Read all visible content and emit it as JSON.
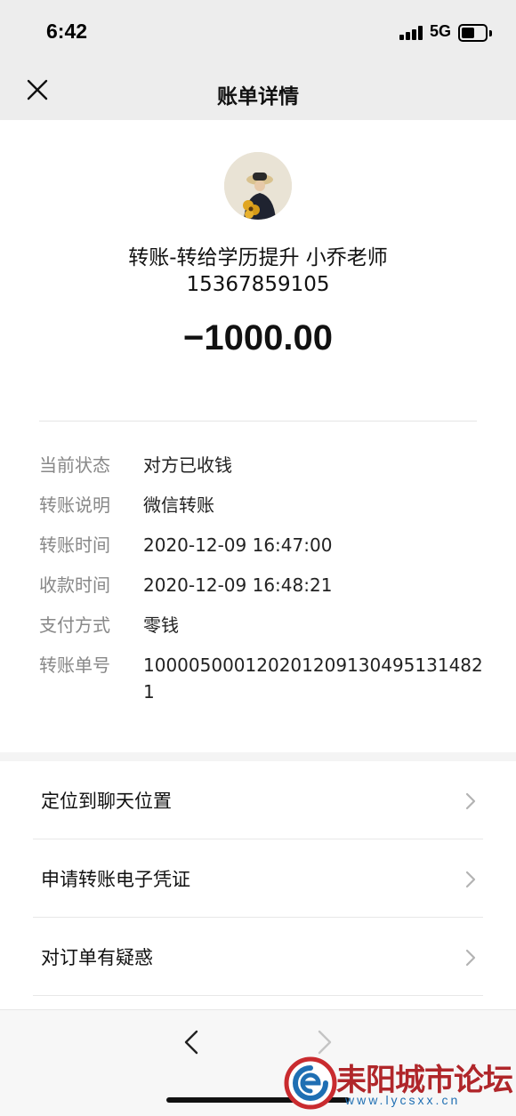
{
  "status_bar": {
    "time": "6:42",
    "network": "5G",
    "icons": [
      "signal-icon",
      "battery-icon"
    ]
  },
  "nav": {
    "title": "账单详情",
    "close_icon": "close-icon"
  },
  "summary": {
    "recipient": "转账-转给学历提升 小乔老师",
    "phone": "15367859105",
    "amount": "−1000.00",
    "avatar": "avatar-image"
  },
  "details": [
    {
      "label": "当前状态",
      "value": "对方已收钱"
    },
    {
      "label": "转账说明",
      "value": "微信转账"
    },
    {
      "label": "转账时间",
      "value": "2020-12-09 16:47:00"
    },
    {
      "label": "收款时间",
      "value": "2020-12-09 16:48:21"
    },
    {
      "label": "支付方式",
      "value": "零钱"
    },
    {
      "label": "转账单号",
      "value": "100005000120201209130495131482​1"
    }
  ],
  "actions": [
    {
      "label": "定位到聊天位置"
    },
    {
      "label": "申请转账电子凭证"
    },
    {
      "label": "对订单有疑惑"
    }
  ],
  "toolbar": {
    "back_icon": "chevron-left-icon",
    "forward_icon": "chevron-right-icon"
  },
  "watermark": {
    "name": "耒阳城市论坛",
    "url": "www.lycsxx.cn"
  },
  "colors": {
    "header_bg": "#ededed",
    "label_gray": "#888888",
    "watermark_red": "#b0262a",
    "watermark_blue": "#1f6fb3"
  }
}
